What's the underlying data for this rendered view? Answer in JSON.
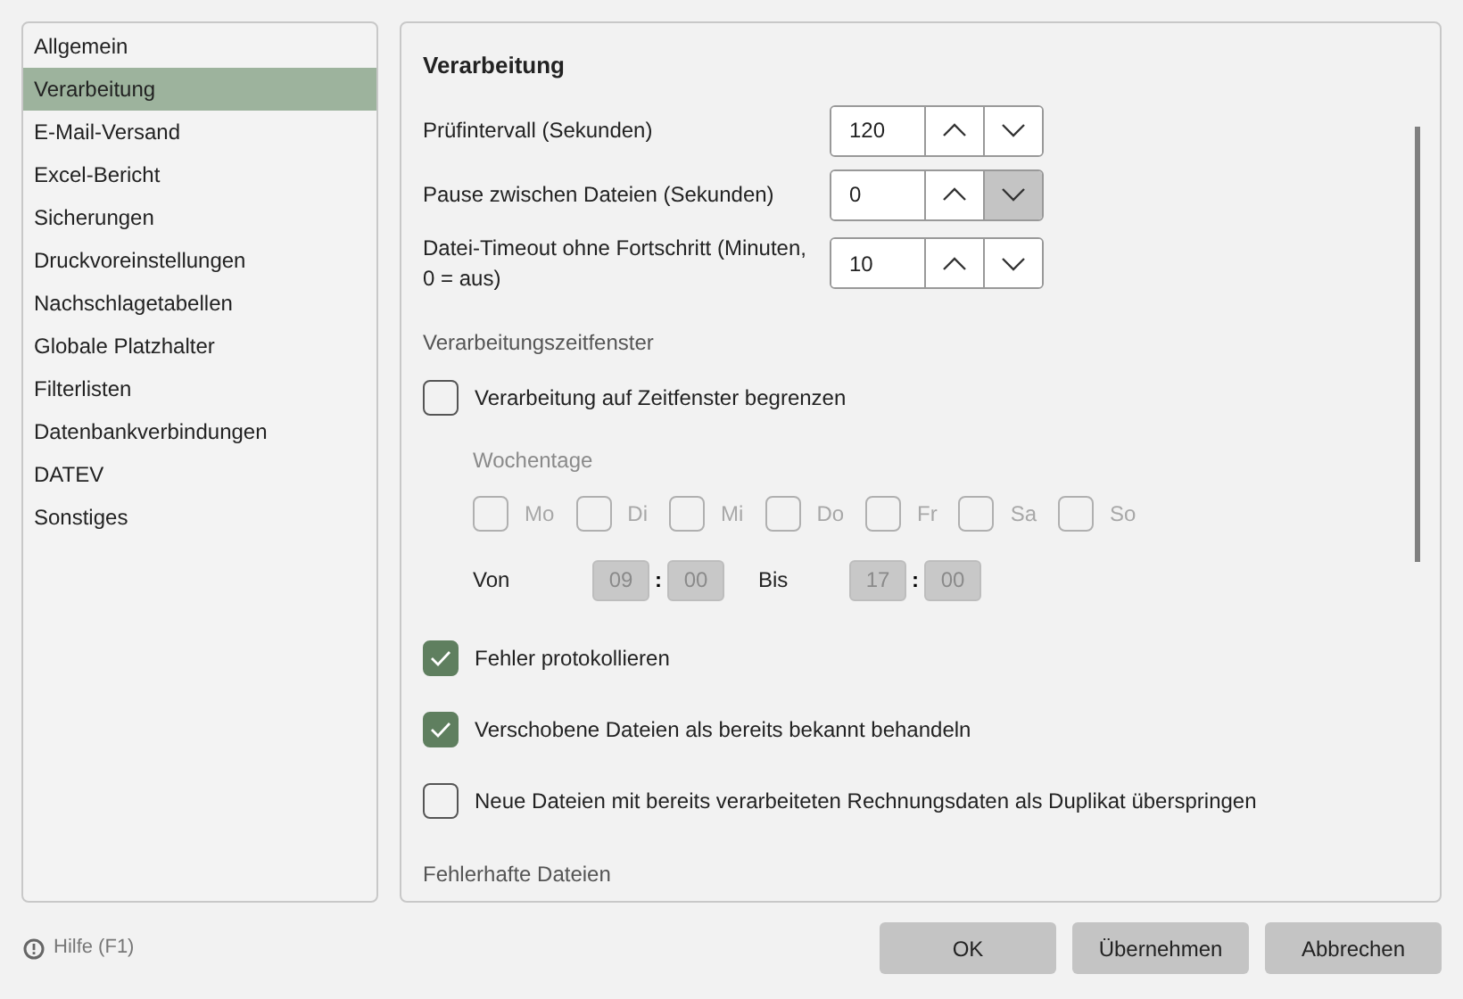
{
  "sidebar": {
    "items": [
      {
        "label": "Allgemein",
        "selected": false
      },
      {
        "label": "Verarbeitung",
        "selected": true
      },
      {
        "label": "E-Mail-Versand",
        "selected": false
      },
      {
        "label": "Excel-Bericht",
        "selected": false
      },
      {
        "label": "Sicherungen",
        "selected": false
      },
      {
        "label": "Druckvoreinstellungen",
        "selected": false
      },
      {
        "label": "Nachschlagetabellen",
        "selected": false
      },
      {
        "label": "Globale Platzhalter",
        "selected": false
      },
      {
        "label": "Filterlisten",
        "selected": false
      },
      {
        "label": "Datenbankverbindungen",
        "selected": false
      },
      {
        "label": "DATEV",
        "selected": false
      },
      {
        "label": "Sonstiges",
        "selected": false
      }
    ]
  },
  "panel": {
    "title": "Verarbeitung",
    "spinners": [
      {
        "label": "Prüfintervall (Sekunden)",
        "value": "120",
        "down_highlighted": false
      },
      {
        "label": "Pause zwischen Dateien (Sekunden)",
        "value": "0",
        "down_highlighted": true
      },
      {
        "label": "Datei-Timeout ohne Fortschritt (Minuten, 0 = aus)",
        "value": "10",
        "down_highlighted": false
      }
    ],
    "window_section": {
      "heading": "Verarbeitungszeitfenster",
      "limit": {
        "label": "Verarbeitung auf Zeitfenster begrenzen",
        "checked": false
      },
      "disabled": true,
      "weekdays_label": "Wochentage",
      "weekdays": [
        {
          "label": "Mo",
          "checked": false
        },
        {
          "label": "Di",
          "checked": false
        },
        {
          "label": "Mi",
          "checked": false
        },
        {
          "label": "Do",
          "checked": false
        },
        {
          "label": "Fr",
          "checked": false
        },
        {
          "label": "Sa",
          "checked": false
        },
        {
          "label": "So",
          "checked": false
        }
      ],
      "from_label": "Von",
      "from_hour": "09",
      "from_minute": "00",
      "separator_1": ":",
      "to_label": "Bis",
      "to_hour": "17",
      "to_minute": "00",
      "separator_2": ":"
    },
    "options": [
      {
        "label": "Fehler protokollieren",
        "checked": true
      },
      {
        "label": "Verschobene Dateien als bereits bekannt behandeln",
        "checked": true
      },
      {
        "label": "Neue Dateien mit bereits verarbeiteten Rechnungsdaten als Duplikat überspringen",
        "checked": false
      }
    ],
    "next_heading": "Fehlerhafte Dateien"
  },
  "footer": {
    "help": "Hilfe (F1)",
    "buttons": [
      "OK",
      "Übernehmen",
      "Abbrechen"
    ]
  }
}
